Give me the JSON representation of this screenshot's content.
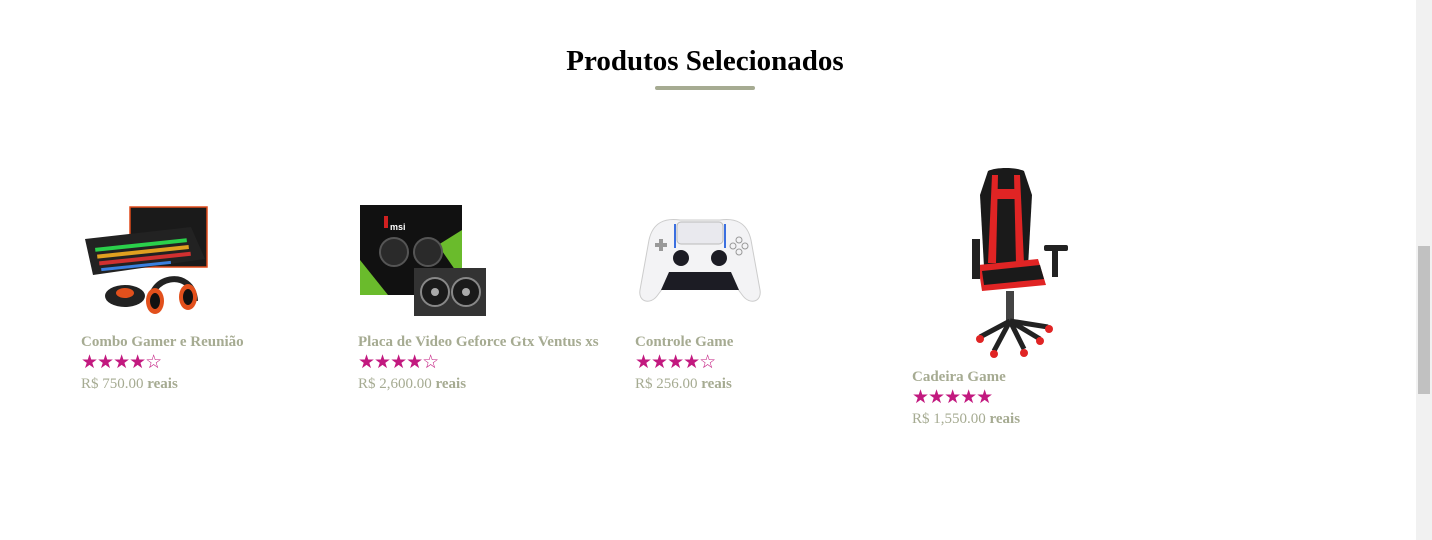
{
  "section": {
    "title": "Produtos Selecionados"
  },
  "products": [
    {
      "name": "Combo Gamer e Reunião",
      "stars": "★★★★☆",
      "price": "R$ 750.00",
      "unit": "reais"
    },
    {
      "name": "Placa de Video Geforce Gtx Ventus xs",
      "stars": "★★★★☆",
      "price": "R$ 2,600.00",
      "unit": "reais"
    },
    {
      "name": "Controle Game",
      "stars": "★★★★☆",
      "price": "R$ 256.00",
      "unit": "reais"
    },
    {
      "name": "Cadeira Game",
      "stars": "★★★★★",
      "price": "R$ 1,550.00",
      "unit": "reais"
    }
  ],
  "colors": {
    "accent": "#a6ab92",
    "star": "#c2197f"
  }
}
